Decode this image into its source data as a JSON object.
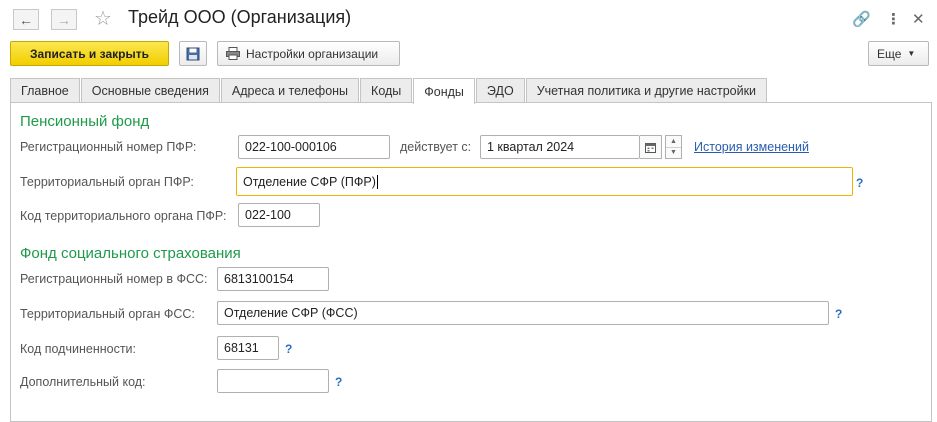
{
  "window": {
    "title": "Трейд ООО (Организация)",
    "back_icon": "arrow-left-icon",
    "forward_icon": "arrow-right-icon",
    "star_icon": "star-icon",
    "link_icon": "link-icon",
    "more_icon": "more-vertical-icon",
    "close_icon": "close-icon"
  },
  "toolbar": {
    "save_close_label": "Записать и закрыть",
    "save_icon": "floppy-disk-icon",
    "settings_label": "Настройки организации",
    "settings_icon": "printer-icon",
    "more_label": "Еще"
  },
  "tabs": [
    {
      "label": "Главное",
      "active": false
    },
    {
      "label": "Основные сведения",
      "active": false
    },
    {
      "label": "Адреса и телефоны",
      "active": false
    },
    {
      "label": "Коды",
      "active": false
    },
    {
      "label": "Фонды",
      "active": true
    },
    {
      "label": "ЭДО",
      "active": false
    },
    {
      "label": "Учетная политика и другие настройки",
      "active": false
    }
  ],
  "pension": {
    "title": "Пенсионный фонд",
    "reg_number_label": "Регистрационный номер ПФР:",
    "reg_number_value": "022-100-000106",
    "valid_from_label": "действует с:",
    "valid_from_value": "1 квартал 2024",
    "history_link": "История изменений",
    "territorial_label": "Территориальный орган ПФР:",
    "territorial_value": "Отделение СФР (ПФР)",
    "territorial_code_label": "Код территориального органа ПФР:",
    "territorial_code_value": "022-100"
  },
  "social": {
    "title": "Фонд социального страхования",
    "reg_number_label": "Регистрационный номер в ФСС:",
    "reg_number_value": "6813100154",
    "territorial_label": "Территориальный орган ФСС:",
    "territorial_value": "Отделение СФР (ФСС)",
    "subordination_label": "Код подчиненности:",
    "subordination_value": "68131",
    "additional_code_label": "Дополнительный код:",
    "additional_code_value": ""
  },
  "help_mark": "?",
  "colors": {
    "accent_green": "#1e9a4a",
    "primary_button": "#f2ce00",
    "focus_border": "#f0b400",
    "link_blue": "#2a5db0"
  }
}
